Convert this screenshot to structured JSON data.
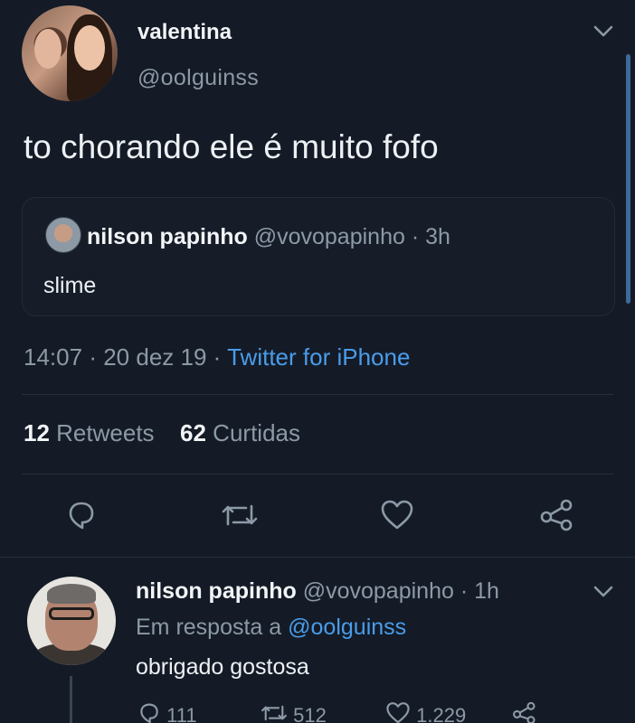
{
  "main_tweet": {
    "display_name": "valentina",
    "handle": "@oolguinss",
    "text": "to chorando ele é muito fofo",
    "time": "14:07",
    "date": "20 dez 19",
    "separator": "·",
    "source": "Twitter for iPhone"
  },
  "quoted_tweet": {
    "display_name": "nilson papinho",
    "handle": "@vovopapinho",
    "age": "3h",
    "separator": "·",
    "text": "slime"
  },
  "stats": {
    "retweets_count": "12",
    "retweets_label": "Retweets",
    "likes_count": "62",
    "likes_label": "Curtidas"
  },
  "actions": {
    "reply_icon": "reply-icon",
    "retweet_icon": "retweet-icon",
    "like_icon": "heart-icon",
    "share_icon": "share-icon"
  },
  "reply": {
    "display_name": "nilson papinho",
    "handle": "@vovopapinho",
    "age": "1h",
    "separator": "·",
    "in_reply_prefix": "Em resposta a",
    "in_reply_user": "@oolguinss",
    "text": "obrigado gostosa",
    "reply_count": "111",
    "retweet_count": "512",
    "like_count": "1.229"
  },
  "colors": {
    "background": "#141b27",
    "accent": "#4a9ce9",
    "muted": "#8c99a6"
  }
}
